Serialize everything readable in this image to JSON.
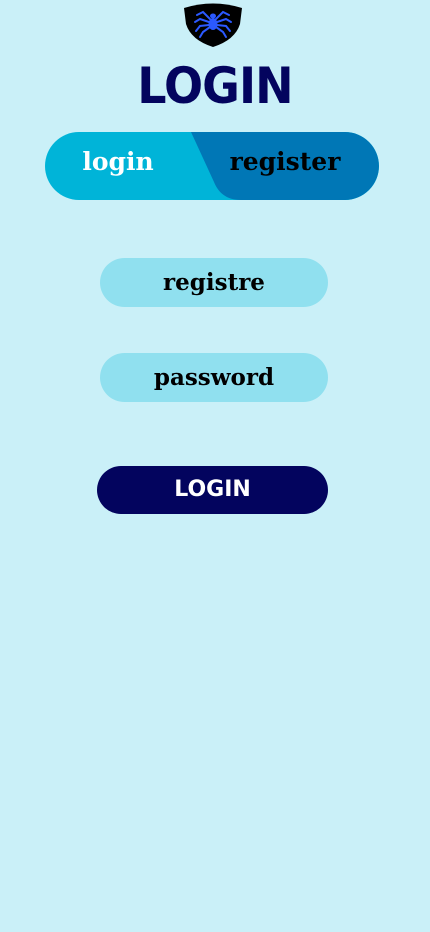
{
  "logo": {
    "icon": "spider-shield-icon",
    "shield_color": "#000000",
    "spider_color": "#2B59FF"
  },
  "title": "LOGIN",
  "tabs": {
    "login_label": "login",
    "register_label": "register",
    "active": "login",
    "login_bg": "#00B4D8",
    "register_bg": "#0077B6"
  },
  "form": {
    "registre_placeholder": "registre",
    "password_placeholder": "password"
  },
  "submit_label": "LOGIN",
  "colors": {
    "background": "#CAF0F8",
    "primary": "#03045E",
    "field_bg": "#90E0EF"
  }
}
